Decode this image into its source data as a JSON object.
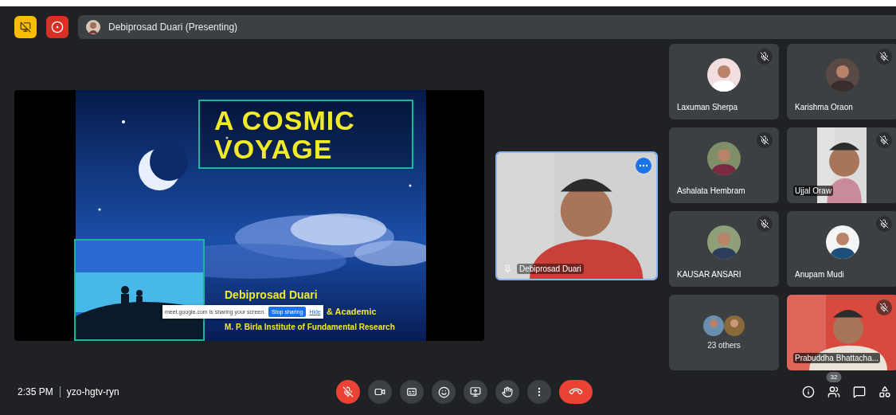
{
  "top_bar": {
    "presenter": "Debiprosad Duari (Presenting)"
  },
  "slide": {
    "title_lines": [
      "A COSMIC",
      "VOYAGE"
    ],
    "speaker": "Debiprosad Duari",
    "role": "& Academic",
    "institute": "M. P. Birla Institute of Fundamental Research",
    "share_notice": {
      "text": "meet.google.com is sharing your screen.",
      "stop_button": "Stop sharing",
      "hide_link": "Hide"
    }
  },
  "presenter_tile": {
    "name": "Debiprosad Duari",
    "pinned": true
  },
  "participants": [
    {
      "kind": "avatar",
      "name": "Laxuman Sherpa",
      "muted": true
    },
    {
      "kind": "avatar",
      "name": "Karishma Oraon",
      "muted": true
    },
    {
      "kind": "avatar",
      "name": "Ashalata Hembram",
      "muted": true
    },
    {
      "kind": "portrait_video",
      "name": "Ujjal Oraw",
      "muted": true
    },
    {
      "kind": "avatar",
      "name": "KAUSAR ANSARI",
      "muted": true
    },
    {
      "kind": "avatar",
      "name": "Anupam Mudi",
      "muted": true
    },
    {
      "kind": "others",
      "name": "23 others",
      "muted": false
    },
    {
      "kind": "video",
      "name": "Prabuddha Bhattacha...",
      "muted": true
    }
  ],
  "bottom_bar": {
    "time": "2:35 PM",
    "meeting_code": "yzo-hgtv-ryn",
    "mic_muted": true,
    "people_count": "32"
  }
}
